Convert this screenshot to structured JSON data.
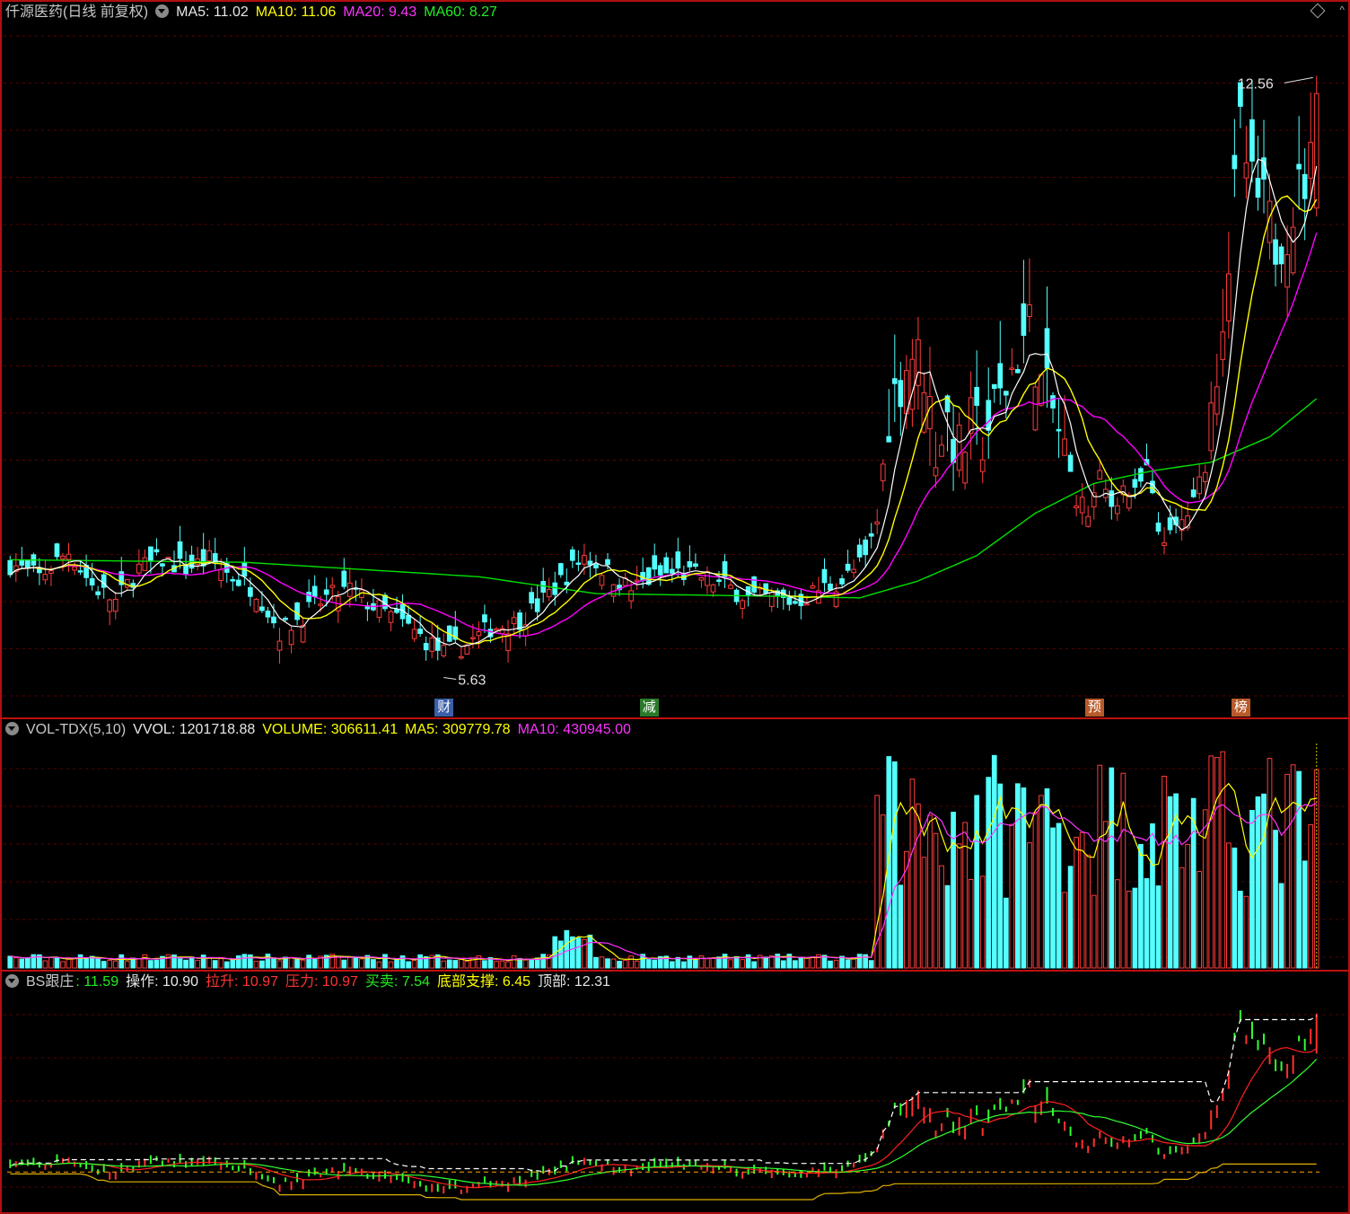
{
  "header_main": {
    "title": "仟源医药(日线 前复权)",
    "ma5": "MA5: 11.02",
    "ma10": "MA10: 11.06",
    "ma20": "MA20: 9.43",
    "ma60": "MA60: 8.27"
  },
  "header_vol": {
    "name": "VOL-TDX(5,10)",
    "vvol": "VVOL: 1201718.88",
    "volume": "VOLUME: 306611.41",
    "ma5": "MA5: 309779.78",
    "ma10": "MA10: 430945.00"
  },
  "header_bs": {
    "name": "BS跟庄",
    "v1": ": 11.59",
    "op": "操作: 10.90",
    "rise": "拉升: 10.97",
    "press": "压力: 10.97",
    "trade": "买卖: 7.54",
    "support": "底部支撑: 6.45",
    "top": "顶部: 12.31"
  },
  "annotations": {
    "high_label": "12.56",
    "low_label": "5.63"
  },
  "event_tags": [
    {
      "text": "财",
      "color": "#3a5fa8",
      "x_index": 74
    },
    {
      "text": "减",
      "color": "#2a7a2a",
      "x_index": 109
    },
    {
      "text": "预",
      "color": "#b85a2a",
      "x_index": 185
    },
    {
      "text": "榜",
      "color": "#b85a2a",
      "x_index": 210
    }
  ],
  "chart_data": {
    "type": "candlestick",
    "bars": 224,
    "price_ylim": [
      5.0,
      13.2
    ],
    "series_colors": {
      "up": "#ff3b3b",
      "down": "#54ffff",
      "ma5": "#ffffff",
      "ma10": "#ffff00",
      "ma20": "#ff00ff",
      "ma60": "#00e000"
    },
    "close_anchors": [
      [
        0,
        6.8
      ],
      [
        5,
        6.65
      ],
      [
        10,
        6.95
      ],
      [
        14,
        6.55
      ],
      [
        18,
        6.35
      ],
      [
        22,
        6.75
      ],
      [
        26,
        6.85
      ],
      [
        30,
        6.75
      ],
      [
        34,
        6.85
      ],
      [
        38,
        6.65
      ],
      [
        42,
        6.5
      ],
      [
        46,
        6.0
      ],
      [
        50,
        6.2
      ],
      [
        54,
        6.4
      ],
      [
        58,
        6.5
      ],
      [
        62,
        6.3
      ],
      [
        66,
        6.15
      ],
      [
        70,
        5.95
      ],
      [
        74,
        5.75
      ],
      [
        78,
        5.85
      ],
      [
        82,
        6.05
      ],
      [
        86,
        6.1
      ],
      [
        90,
        6.3
      ],
      [
        94,
        6.6
      ],
      [
        98,
        6.9
      ],
      [
        102,
        6.7
      ],
      [
        106,
        6.5
      ],
      [
        110,
        6.65
      ],
      [
        114,
        6.7
      ],
      [
        118,
        6.65
      ],
      [
        122,
        6.55
      ],
      [
        126,
        6.4
      ],
      [
        130,
        6.4
      ],
      [
        134,
        6.35
      ],
      [
        138,
        6.5
      ],
      [
        142,
        6.6
      ],
      [
        146,
        6.85
      ],
      [
        148,
        7.3
      ],
      [
        150,
        8.6
      ],
      [
        152,
        9.0
      ],
      [
        154,
        9.3
      ],
      [
        156,
        9.1
      ],
      [
        158,
        8.2
      ],
      [
        160,
        8.5
      ],
      [
        162,
        8.1
      ],
      [
        164,
        8.4
      ],
      [
        166,
        8.3
      ],
      [
        168,
        8.6
      ],
      [
        170,
        8.9
      ],
      [
        172,
        9.3
      ],
      [
        174,
        9.6
      ],
      [
        176,
        8.9
      ],
      [
        178,
        8.6
      ],
      [
        180,
        8.1
      ],
      [
        182,
        7.6
      ],
      [
        184,
        7.4
      ],
      [
        186,
        7.8
      ],
      [
        188,
        7.5
      ],
      [
        190,
        7.7
      ],
      [
        192,
        7.6
      ],
      [
        194,
        7.9
      ],
      [
        196,
        7.2
      ],
      [
        198,
        7.1
      ],
      [
        200,
        7.3
      ],
      [
        202,
        7.5
      ],
      [
        204,
        8.0
      ],
      [
        206,
        9.2
      ],
      [
        208,
        10.4
      ],
      [
        210,
        11.9
      ],
      [
        212,
        11.2
      ],
      [
        214,
        11.0
      ],
      [
        216,
        10.6
      ],
      [
        218,
        10.8
      ],
      [
        220,
        11.2
      ],
      [
        222,
        11.5
      ],
      [
        223,
        12.4
      ]
    ],
    "ma60_anchors": [
      [
        0,
        6.85
      ],
      [
        40,
        6.82
      ],
      [
        80,
        6.65
      ],
      [
        100,
        6.45
      ],
      [
        130,
        6.42
      ],
      [
        145,
        6.4
      ],
      [
        155,
        6.6
      ],
      [
        165,
        6.9
      ],
      [
        175,
        7.4
      ],
      [
        185,
        7.75
      ],
      [
        195,
        7.9
      ],
      [
        205,
        8.0
      ],
      [
        215,
        8.3
      ],
      [
        223,
        8.75
      ]
    ],
    "volume_ylim": [
      0,
      1300000
    ],
    "volume_ref": {
      "volume": 306611.41,
      "ma5": 309779.78,
      "ma10": 430945.0
    },
    "bs_ylim": [
      5.0,
      13.2
    ],
    "bs_levels": {
      "value": 11.59,
      "op": 10.9,
      "rise": 10.97,
      "press": 10.97,
      "trade": 7.54,
      "bottom_support": 6.45,
      "top": 12.31
    }
  }
}
